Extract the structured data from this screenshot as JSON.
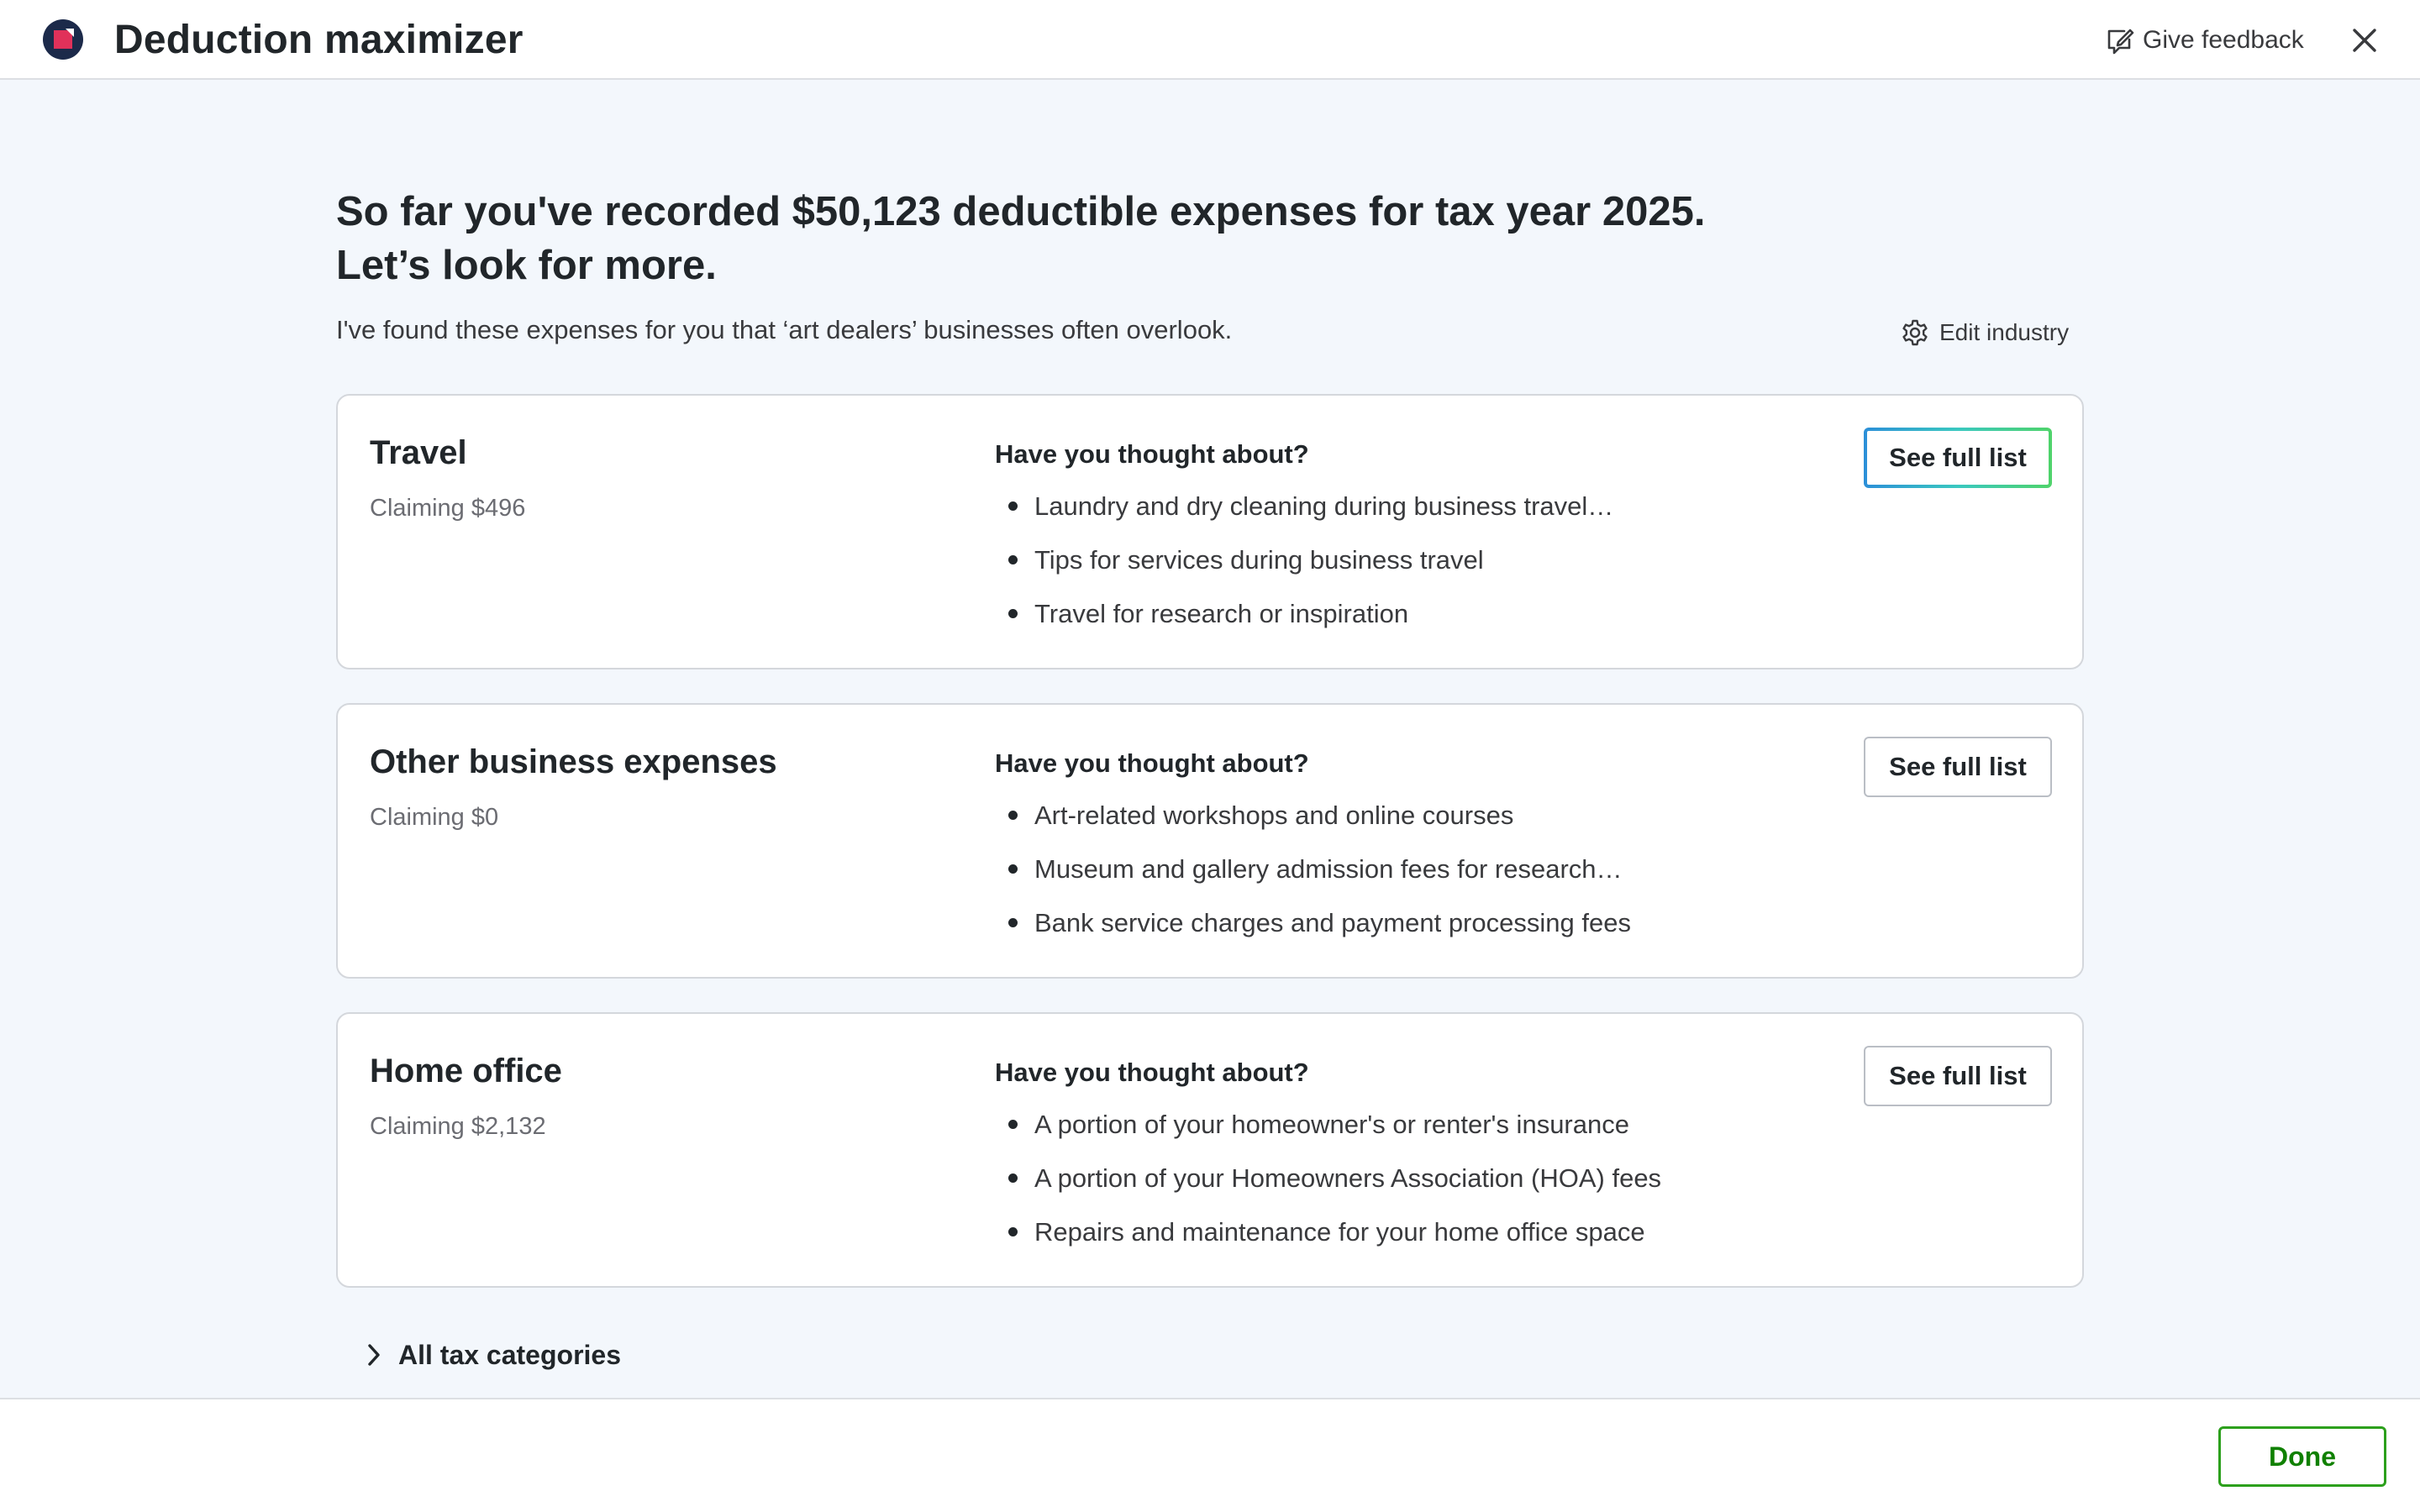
{
  "header": {
    "title": "Deduction maximizer",
    "feedback_label": "Give feedback"
  },
  "intro": {
    "headline_line1": "So far you've recorded $50,123 deductible expenses for tax year 2025.",
    "headline_line2": "Let’s look for more.",
    "subtext": "I've found these expenses for you that ‘art dealers’ businesses often overlook.",
    "edit_industry_label": "Edit industry"
  },
  "cards": [
    {
      "title": "Travel",
      "claiming": "Claiming $496",
      "question": "Have you thought about?",
      "items": [
        "Laundry and dry cleaning during business travel…",
        "Tips for services during business travel",
        "Travel for research or inspiration"
      ],
      "button": "See full list"
    },
    {
      "title": "Other business expenses",
      "claiming": "Claiming $0",
      "question": "Have you thought about?",
      "items": [
        "Art-related workshops and online courses",
        "Museum and gallery admission fees for research…",
        "Bank service charges and payment processing fees"
      ],
      "button": "See full list"
    },
    {
      "title": "Home office",
      "claiming": "Claiming $2,132",
      "question": "Have you thought about?",
      "items": [
        "A portion of your homeowner's or renter's insurance",
        "A portion of your Homeowners Association (HOA) fees",
        "Repairs and maintenance for your home office space"
      ],
      "button": "See full list"
    }
  ],
  "all_categories_label": "All tax categories",
  "footer": {
    "done_label": "Done"
  },
  "colors": {
    "brand": "#1c2a4a",
    "logo_accent": "#e0315a",
    "done_green": "#2ca01c",
    "page_bg": "#f3f7fc"
  }
}
